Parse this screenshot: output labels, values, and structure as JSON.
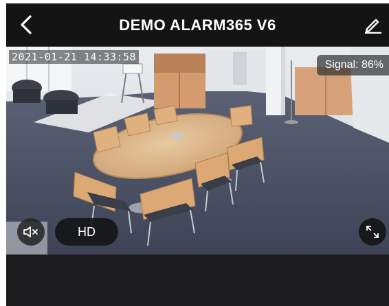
{
  "header": {
    "title": "DEMO ALARM365 V6",
    "back_icon": "chevron-left-icon",
    "edit_icon": "pencil-icon"
  },
  "video": {
    "timestamp": "2021-01-21 14:33:58",
    "signal_label": "Signal: 86%",
    "signal_percent": 86
  },
  "controls": {
    "mute_icon": "speaker-muted-icon",
    "quality_label": "HD",
    "fullscreen_icon": "fullscreen-icon"
  },
  "colors": {
    "background": "#141414",
    "text": "#ffffff",
    "overlay": "#323232"
  }
}
